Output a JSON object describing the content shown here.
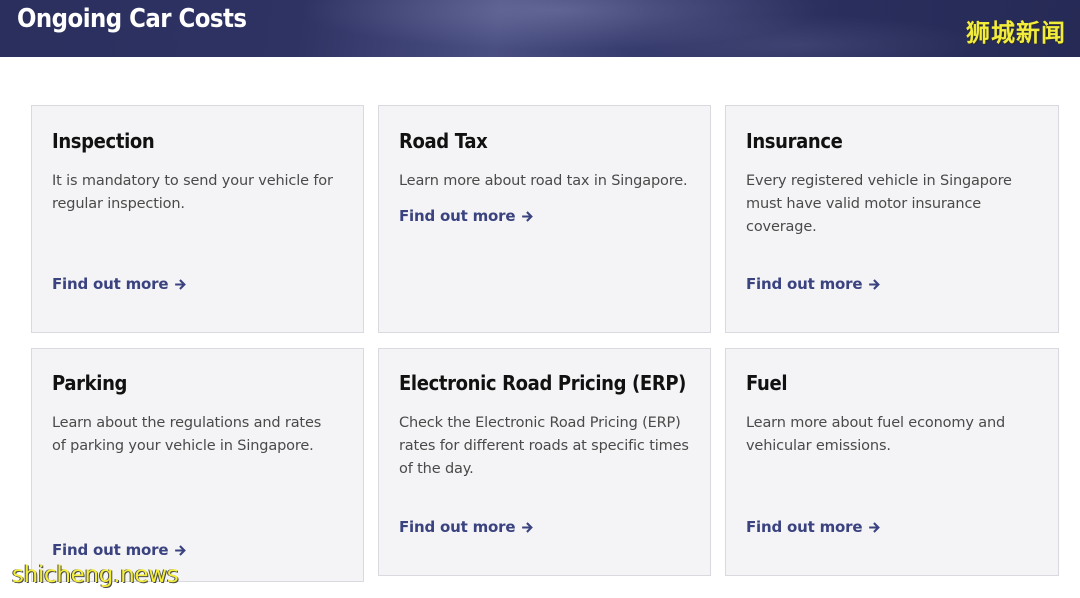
{
  "banner": {
    "title": "Ongoing Car Costs",
    "watermark": "狮城新闻"
  },
  "cards": [
    {
      "title": "Inspection",
      "description": "It is mandatory to send your vehicle for regular inspection.",
      "link": "Find out more"
    },
    {
      "title": "Road Tax",
      "description": "Learn more about road tax in Singapore.",
      "link": "Find out more"
    },
    {
      "title": "Insurance",
      "description": "Every registered vehicle in Singapore must have valid motor insurance coverage.",
      "link": "Find out more"
    },
    {
      "title": "Parking",
      "description": "Learn about the regulations and rates of parking your vehicle in Singapore.",
      "link": "Find out more"
    },
    {
      "title": "Electronic Road Pricing (ERP)",
      "description": "Check the Electronic Road Pricing (ERP) rates for different roads at specific times of the day.",
      "link": "Find out more"
    },
    {
      "title": "Fuel",
      "description": "Learn more about fuel economy and vehicular emissions.",
      "link": "Find out more"
    }
  ],
  "link_icon": "arrow-right-icon",
  "colors": {
    "banner": "#2b2f5e",
    "link": "#3a427f",
    "card_background": "#f4f4f6",
    "watermark": "#f2ec3a"
  },
  "site_watermark": "shicheng.news"
}
